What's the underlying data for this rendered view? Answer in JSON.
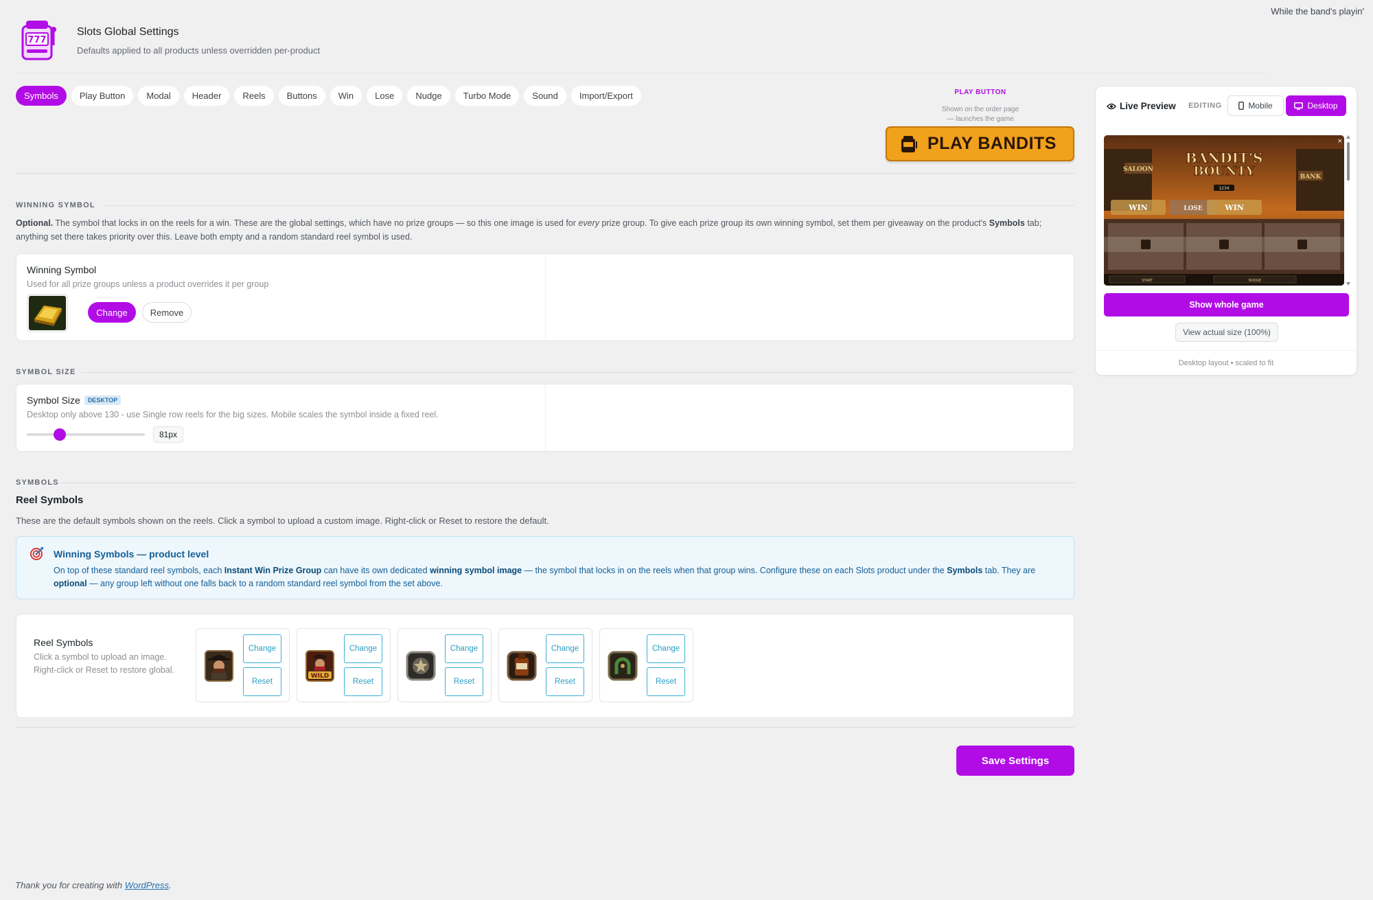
{
  "top_note": "While the band's playin'",
  "header": {
    "title": "Slots Global Settings",
    "subtitle": "Defaults applied to all products unless overridden per-product",
    "logo_icon": "slot-machine-icon"
  },
  "tabs": [
    {
      "label": "Symbols",
      "active": true
    },
    {
      "label": "Play Button"
    },
    {
      "label": "Modal"
    },
    {
      "label": "Header"
    },
    {
      "label": "Reels"
    },
    {
      "label": "Buttons"
    },
    {
      "label": "Win"
    },
    {
      "label": "Lose"
    },
    {
      "label": "Nudge"
    },
    {
      "label": "Turbo Mode"
    },
    {
      "label": "Sound"
    },
    {
      "label": "Import/Export"
    }
  ],
  "play_button_preview": {
    "label": "PLAY BUTTON",
    "note_line1": "Shown on the order page",
    "note_line2": "— launches the game",
    "button_text": "PLAY BANDITS"
  },
  "winning_symbol": {
    "section_label": "WINNING SYMBOL",
    "desc_prefix": "Optional.",
    "desc_part1": " The symbol that locks in on the reels for a win. These are the global settings, which have no prize groups — so this one image is used for ",
    "desc_every": "every",
    "desc_part2": " prize group. To give each prize group its own winning symbol, set them per giveaway on the product's ",
    "desc_symbols": "Symbols",
    "desc_part3": " tab; anything set there takes priority over this. Leave both empty and a random standard reel symbol is used.",
    "card_title": "Winning Symbol",
    "card_sub": "Used for all prize groups unless a product overrides it per group",
    "change_label": "Change",
    "remove_label": "Remove"
  },
  "symbol_size": {
    "section_label": "SYMBOL SIZE",
    "title": "Symbol Size",
    "badge": "DESKTOP",
    "sub": "Desktop only above 130 - use Single row reels for the big sizes. Mobile scales the symbol inside a fixed reel.",
    "value_label": "81px",
    "slider_fraction": 0.28
  },
  "symbols": {
    "section_label": "SYMBOLS",
    "heading": "Reel Symbols",
    "desc": "These are the default symbols shown on the reels. Click a symbol to upload a custom image. Right-click or Reset to restore the default."
  },
  "info": {
    "title": "Winning Symbols — product level",
    "p1": "On top of these standard reel symbols, each ",
    "b1": "Instant Win Prize Group",
    "p2": " can have its own dedicated ",
    "b2": "winning symbol image",
    "p3": " — the symbol that locks in on the reels when that group wins. Configure these on each Slots product under the ",
    "b3": "Symbols",
    "p4": " tab. They are ",
    "b4": "optional",
    "p5": " — any group left without one falls back to a random standard reel symbol from the set above."
  },
  "reel_card": {
    "title": "Reel Symbols",
    "sub_line1": "Click a symbol to upload an image.",
    "sub_line2": "Right-click or Reset to restore global.",
    "symbols": [
      {
        "icon": "bandit-symbol-icon",
        "change": "Change",
        "reset": "Reset"
      },
      {
        "icon": "wild-symbol-icon",
        "change": "Change",
        "reset": "Reset"
      },
      {
        "icon": "badge-symbol-icon",
        "change": "Change",
        "reset": "Reset"
      },
      {
        "icon": "whiskey-symbol-icon",
        "change": "Change",
        "reset": "Reset"
      },
      {
        "icon": "horseshoe-symbol-icon",
        "change": "Change",
        "reset": "Reset"
      }
    ]
  },
  "save_label": "Save Settings",
  "footer": {
    "text": "Thank you for creating with ",
    "link": "WordPress",
    "suffix": "."
  },
  "preview": {
    "title": "Live Preview",
    "editing_label": "EDITING",
    "mobile_label": "Mobile",
    "desktop_label": "Desktop",
    "game_title_line1": "BANDIT'S",
    "game_title_line2": "BOUNTY",
    "game_counter": "1234",
    "game_win_label": "WIN",
    "game_lose_label": "LOSE",
    "game_saloon": "SALOON",
    "game_bank": "BANK",
    "game_start": "START",
    "game_nudge": "NUDGE",
    "show_whole": "Show whole game",
    "actual_size": "View actual size (100%)",
    "foot": "Desktop layout • scaled to fit"
  },
  "colors": {
    "accent": "#b20ce6",
    "play_button": "#f1a11b",
    "info_text": "#135e96"
  }
}
